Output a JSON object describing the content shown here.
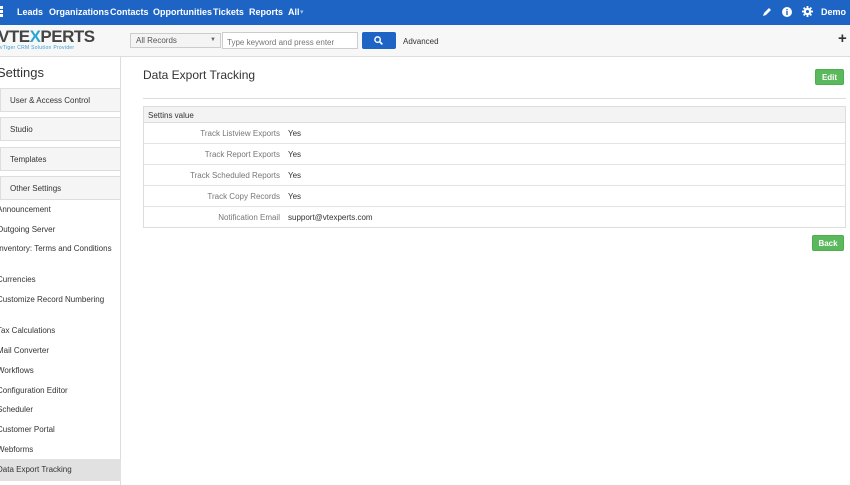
{
  "topnav": {
    "items": [
      "Leads",
      "Organizations",
      "Contacts",
      "Opportunities",
      "Tickets",
      "Reports",
      "All"
    ],
    "user": "Demo"
  },
  "header": {
    "logo_brand_left": "VTE",
    "logo_brand_x": "X",
    "logo_brand_right": "PERTS",
    "logo_tag": "vTiger CRM Solution Provider",
    "records_select": "All Records",
    "search_placeholder": "Type keyword and press enter",
    "advanced_label": "Advanced"
  },
  "sidebar": {
    "title": "Settings",
    "sections": [
      "User & Access Control",
      "Studio",
      "Templates",
      "Other Settings"
    ],
    "links": [
      "Announcement",
      "Outgoing Server",
      "Inventory: Terms and Conditions",
      "Currencies",
      "Customize Record Numbering",
      "Tax Calculations",
      "Mail Converter",
      "Workflows",
      "Configuration Editor",
      "Scheduler",
      "Customer Portal",
      "Webforms"
    ],
    "active": "Data Export Tracking"
  },
  "main": {
    "title": "Data Export Tracking",
    "edit_label": "Edit",
    "back_label": "Back",
    "panel_heading": "Settins value",
    "rows": [
      {
        "label": "Track Listview Exports",
        "value": "Yes"
      },
      {
        "label": "Track Report Exports",
        "value": "Yes"
      },
      {
        "label": "Track Scheduled Reports",
        "value": "Yes"
      },
      {
        "label": "Track Copy Records",
        "value": "Yes"
      },
      {
        "label": "Notification Email",
        "value": "support@vtexperts.com"
      }
    ]
  },
  "colors": {
    "nav": "#1e64c4",
    "button_green": "#5cb85c"
  }
}
